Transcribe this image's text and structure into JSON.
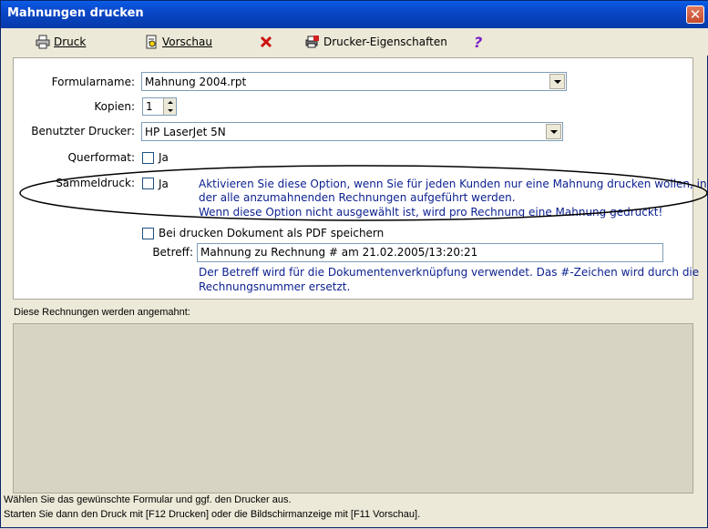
{
  "window": {
    "title": "Mahnungen drucken"
  },
  "toolbar": {
    "druck_label": "Druck",
    "vorschau_label": "Vorschau",
    "druckereigenschaften_label": "Drucker-Eigenschaften"
  },
  "form": {
    "formularname_label": "Formularname:",
    "formularname_value": "Mahnung 2004.rpt",
    "kopien_label": "Kopien:",
    "kopien_value": "1",
    "drucker_label": "Benutzter Drucker:",
    "drucker_value": "HP LaserJet 5N",
    "querformat_label": "Querformat:",
    "querformat_option": "Ja",
    "sammeldruck_label": "Sammeldruck:",
    "sammeldruck_option": "Ja",
    "sammeldruck_hint_1": "Aktivieren Sie diese Option, wenn Sie für jeden Kunden nur eine Mahnung drucken wollen, in",
    "sammeldruck_hint_2": "der alle anzumahnenden Rechnungen aufgeführt werden.",
    "sammeldruck_hint_3": "Wenn diese Option nicht ausgewählt ist, wird pro Rechnung eine Mahnung gedruckt!",
    "pdf_label": "Bei drucken Dokument als PDF speichern",
    "betreff_label": "Betreff:",
    "betreff_value": "Mahnung zu Rechnung # am 21.02.2005/13:20:21",
    "betreff_hint_1": "Der Betreff wird für die Dokumentenverknüpfung verwendet. Das #-Zeichen wird durch die",
    "betreff_hint_2": "Rechnungsnummer ersetzt."
  },
  "list": {
    "caption": "Diese Rechnungen werden angemahnt:"
  },
  "status": {
    "line_1": "Wählen Sie das gewünschte Formular und ggf. den Drucker aus.",
    "line_2": "Starten Sie dann den Druck mit [F12 Drucken] oder die Bildschirmanzeige mit [F11 Vorschau]."
  },
  "colors": {
    "titlebar": "#0a46c8",
    "hint_text": "#0a1f8f",
    "cancel_icon": "#cc1111",
    "help_icon": "#7a1fc8"
  }
}
